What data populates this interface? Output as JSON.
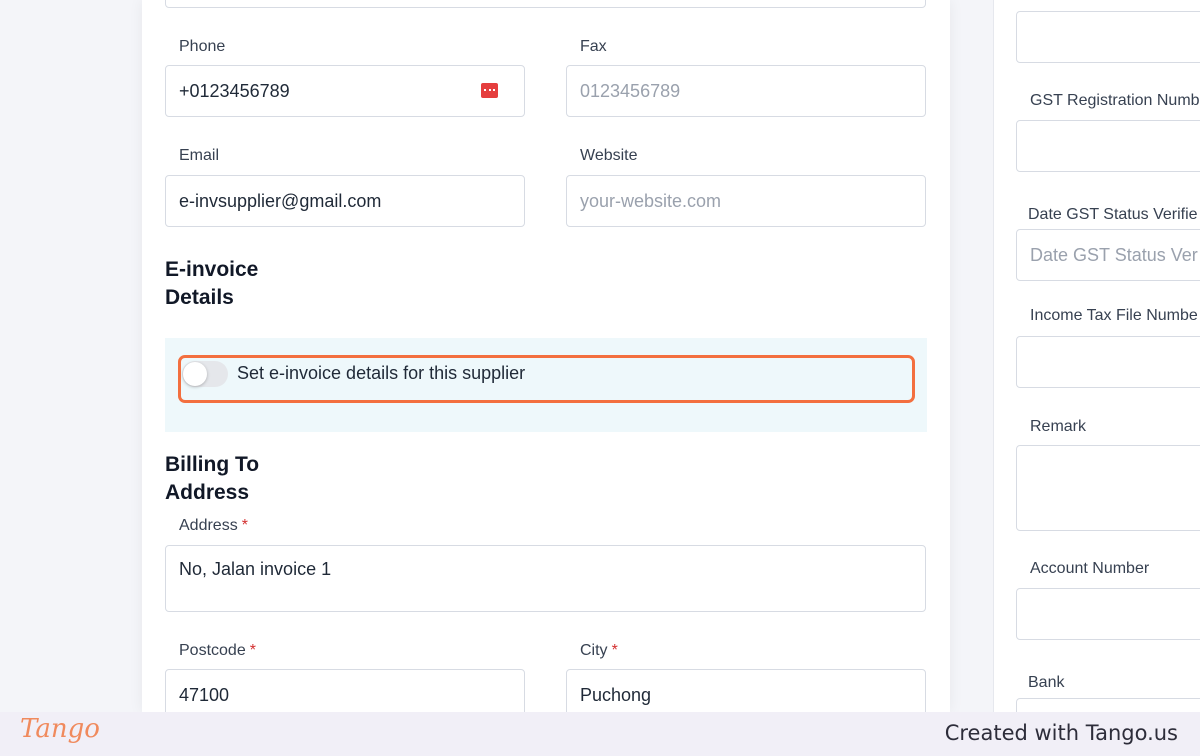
{
  "left_form": {
    "phone": {
      "label": "Phone",
      "value": "+0123456789"
    },
    "fax": {
      "label": "Fax",
      "placeholder": "0123456789"
    },
    "email": {
      "label": "Email",
      "value": "e-invsupplier@gmail.com"
    },
    "website": {
      "label": "Website",
      "placeholder": "your-website.com"
    },
    "einvoice_section": {
      "title_line1": "E-invoice",
      "title_line2": "Details",
      "toggle_label": "Set e-invoice details for this supplier",
      "toggle_on": false
    },
    "billing_section": {
      "title_line1": "Billing To",
      "title_line2": "Address"
    },
    "address": {
      "label": "Address",
      "required_mark": "*",
      "value": "No, Jalan invoice 1"
    },
    "postcode": {
      "label": "Postcode",
      "required_mark": "*",
      "value": "47100"
    },
    "city": {
      "label": "City",
      "required_mark": "*",
      "value": "Puchong"
    }
  },
  "right_form": {
    "gst_registration": {
      "label": "GST Registration Numb"
    },
    "date_gst_status": {
      "label": "Date GST Status Verifie",
      "placeholder": "Date GST Status Ver"
    },
    "income_tax": {
      "label": "Income Tax File Numbe"
    },
    "remark": {
      "label": "Remark"
    },
    "account_number": {
      "label": "Account Number"
    },
    "bank": {
      "label": "Bank"
    }
  },
  "footer": {
    "logo_text": "Tango",
    "created_with": "Created with Tango.us"
  },
  "colors": {
    "highlight": "#f36f3f",
    "einvoice_panel_bg": "#eef8fb",
    "required": "#d32f2f",
    "phone_icon": "#e53e3e"
  },
  "icons": [
    "card-icon"
  ]
}
